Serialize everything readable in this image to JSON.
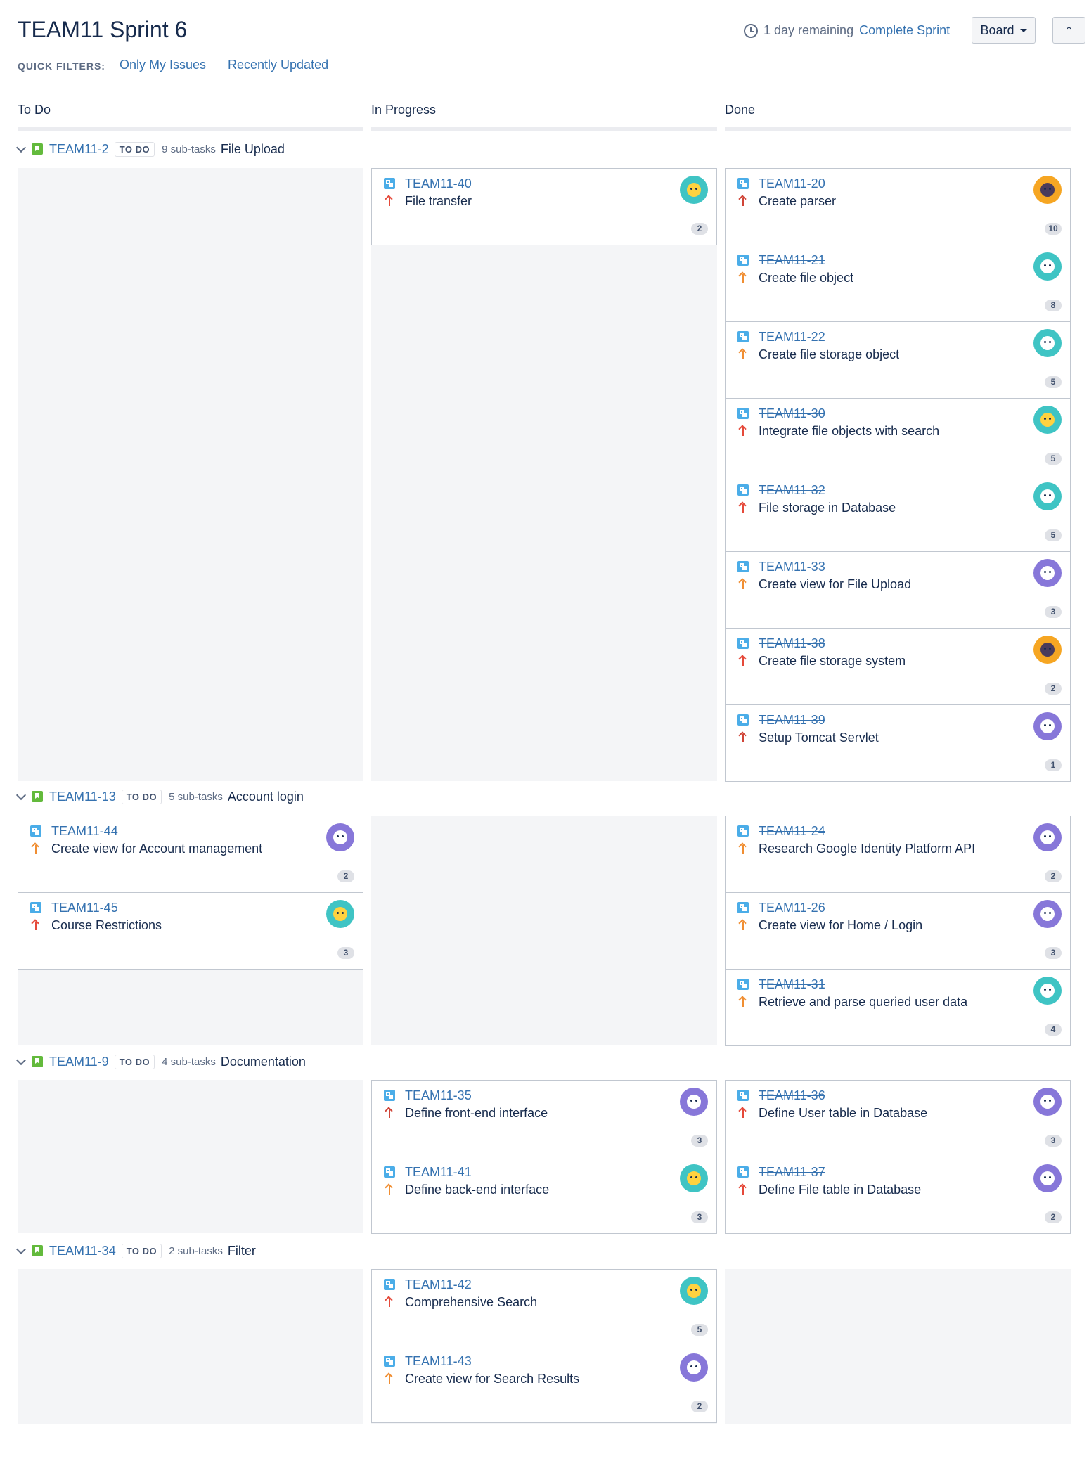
{
  "header": {
    "title": "TEAM11 Sprint 6",
    "quick_filters_label": "QUICK FILTERS:",
    "quick_filters": [
      "Only My Issues",
      "Recently Updated"
    ],
    "remaining": "1 day remaining",
    "complete_sprint": "Complete Sprint",
    "board_button": "Board"
  },
  "columns": [
    "To Do",
    "In Progress",
    "Done"
  ],
  "swimlanes": [
    {
      "key": "TEAM11-2",
      "status": "TO DO",
      "subtasks": "9 sub-tasks",
      "summary": "File Upload",
      "todo": [],
      "inprogress": [
        {
          "key": "TEAM11-40",
          "summary": "File transfer",
          "priority": "high",
          "avatar": "teal-yellow",
          "points": "2"
        }
      ],
      "done": [
        {
          "key": "TEAM11-20",
          "summary": "Create parser",
          "priority": "highest",
          "avatar": "orange-dark",
          "points": "10"
        },
        {
          "key": "TEAM11-21",
          "summary": "Create file object",
          "priority": "med",
          "avatar": "teal-white",
          "points": "8"
        },
        {
          "key": "TEAM11-22",
          "summary": "Create file storage object",
          "priority": "med",
          "avatar": "teal-white",
          "points": "5"
        },
        {
          "key": "TEAM11-30",
          "summary": "Integrate file objects with search",
          "priority": "high",
          "avatar": "teal-yellow",
          "points": "5"
        },
        {
          "key": "TEAM11-32",
          "summary": "File storage in Database",
          "priority": "high",
          "avatar": "teal-white",
          "points": "5"
        },
        {
          "key": "TEAM11-33",
          "summary": "Create view for File Upload",
          "priority": "med",
          "avatar": "purple-white",
          "points": "3"
        },
        {
          "key": "TEAM11-38",
          "summary": "Create file storage system",
          "priority": "high",
          "avatar": "orange-dark",
          "points": "2"
        },
        {
          "key": "TEAM11-39",
          "summary": "Setup Tomcat Servlet",
          "priority": "highest",
          "avatar": "purple-white",
          "points": "1"
        }
      ]
    },
    {
      "key": "TEAM11-13",
      "status": "TO DO",
      "subtasks": "5 sub-tasks",
      "summary": "Account login",
      "todo": [
        {
          "key": "TEAM11-44",
          "summary": "Create view for Account management",
          "priority": "med",
          "avatar": "purple-white",
          "points": "2"
        },
        {
          "key": "TEAM11-45",
          "summary": "Course Restrictions",
          "priority": "high",
          "avatar": "teal-yellow",
          "points": "3"
        }
      ],
      "inprogress": [],
      "done": [
        {
          "key": "TEAM11-24",
          "summary": "Research Google Identity Platform API",
          "priority": "med",
          "avatar": "purple-white",
          "points": "2"
        },
        {
          "key": "TEAM11-26",
          "summary": "Create view for Home / Login",
          "priority": "med",
          "avatar": "purple-white",
          "points": "3"
        },
        {
          "key": "TEAM11-31",
          "summary": "Retrieve and parse queried user data",
          "priority": "med",
          "avatar": "teal-white",
          "points": "4"
        }
      ]
    },
    {
      "key": "TEAM11-9",
      "status": "TO DO",
      "subtasks": "4 sub-tasks",
      "summary": "Documentation",
      "todo": [],
      "inprogress": [
        {
          "key": "TEAM11-35",
          "summary": "Define front-end interface",
          "priority": "highest",
          "avatar": "purple-white",
          "points": "3"
        },
        {
          "key": "TEAM11-41",
          "summary": "Define back-end interface",
          "priority": "med",
          "avatar": "teal-yellow",
          "points": "3"
        }
      ],
      "done": [
        {
          "key": "TEAM11-36",
          "summary": "Define User table in Database",
          "priority": "high",
          "avatar": "purple-white",
          "points": "3"
        },
        {
          "key": "TEAM11-37",
          "summary": "Define File table in Database",
          "priority": "high",
          "avatar": "purple-white",
          "points": "2"
        }
      ]
    },
    {
      "key": "TEAM11-34",
      "status": "TO DO",
      "subtasks": "2 sub-tasks",
      "summary": "Filter",
      "todo": [],
      "inprogress": [
        {
          "key": "TEAM11-42",
          "summary": "Comprehensive Search",
          "priority": "high",
          "avatar": "teal-yellow",
          "points": "5"
        },
        {
          "key": "TEAM11-43",
          "summary": "Create view for Search Results",
          "priority": "med",
          "avatar": "purple-white",
          "points": "2"
        }
      ],
      "done": []
    }
  ],
  "colors": {
    "accent": "#3572b0",
    "story": "#63ba3c",
    "subtask": "#4bade8",
    "priority_high": "#e5493a",
    "priority_medium": "#f08e32"
  }
}
